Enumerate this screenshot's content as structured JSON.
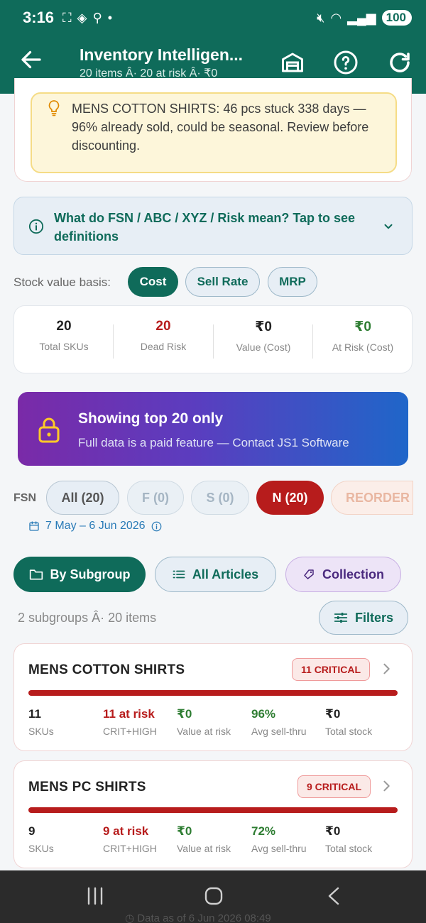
{
  "status": {
    "time": "3:16",
    "battery": "100"
  },
  "appbar": {
    "title": "Inventory Intelligen...",
    "subtitle": "20 items Â· 20 at risk Â· ₹0"
  },
  "hint": {
    "text": "MENS COTTON SHIRTS: 46 pcs stuck 338 days — 96% already sold, could be seasonal. Review before discounting."
  },
  "definitions": {
    "text": "What do FSN / ABC / XYZ / Risk mean?  Tap to see definitions"
  },
  "basis": {
    "label": "Stock value basis:",
    "options": [
      "Cost",
      "Sell Rate",
      "MRP"
    ],
    "selected": "Cost"
  },
  "stats": [
    {
      "value": "20",
      "label": "Total SKUs",
      "color": "#222222"
    },
    {
      "value": "20",
      "label": "Dead Risk",
      "color": "#b71c1c"
    },
    {
      "value": "₹0",
      "label": "Value (Cost)",
      "color": "#222222"
    },
    {
      "value": "₹0",
      "label": "At Risk (Cost)",
      "color": "#2e7d32"
    }
  ],
  "promo": {
    "title": "Showing top 20 only",
    "subtitle": "Full data is a paid feature — Contact JS1 Software"
  },
  "fsn": {
    "label": "FSN",
    "chips": [
      "All (20)",
      "F (0)",
      "S (0)",
      "N (20)",
      "REORDER ("
    ],
    "selected": "N (20)",
    "date_range": "7 May – 6 Jun 2026"
  },
  "views": {
    "subgroup": "By Subgroup",
    "articles": "All Articles",
    "collection": "Collection"
  },
  "summary": {
    "count": "2 subgroups Â· 20 items",
    "filters": "Filters"
  },
  "subgroups": [
    {
      "name": "MENS COTTON SHIRTS",
      "badge": "11 CRITICAL",
      "metrics": [
        {
          "value": "11",
          "label": "SKUs"
        },
        {
          "value": "11 at risk",
          "label": "CRIT+HIGH"
        },
        {
          "value": "₹0",
          "label": "Value at risk"
        },
        {
          "value": "96%",
          "label": "Avg sell-thru"
        },
        {
          "value": "₹0",
          "label": "Total stock"
        }
      ]
    },
    {
      "name": "MENS PC SHIRTS",
      "badge": "9 CRITICAL",
      "metrics": [
        {
          "value": "9",
          "label": "SKUs"
        },
        {
          "value": "9 at risk",
          "label": "CRIT+HIGH"
        },
        {
          "value": "₹0",
          "label": "Value at risk"
        },
        {
          "value": "72%",
          "label": "Avg sell-thru"
        },
        {
          "value": "₹0",
          "label": "Total stock"
        }
      ]
    }
  ],
  "footer": {
    "note": "Data as of 6 Jun 2026 08:49"
  },
  "colors": {
    "brand": "#0f6b5a",
    "critical": "#b71c1c",
    "positive": "#2e7d32"
  }
}
